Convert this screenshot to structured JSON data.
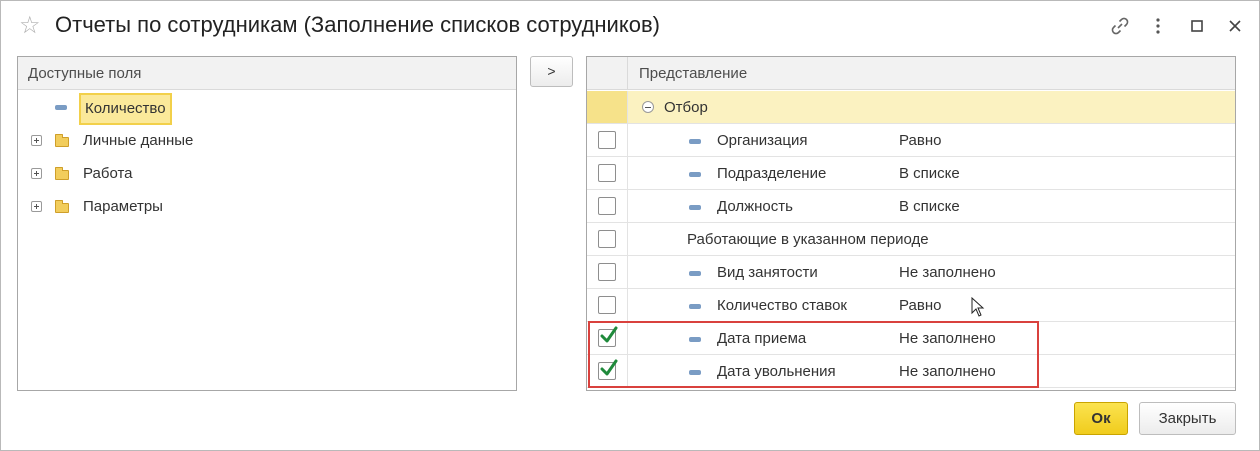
{
  "window": {
    "title": "Отчеты по сотрудникам (Заполнение списков сотрудников)"
  },
  "titlebar_icons": [
    "star-icon",
    "link-icon",
    "more-icon",
    "maximize-icon",
    "close-icon"
  ],
  "left_panel": {
    "header": "Доступные поля",
    "items": [
      {
        "label": "Количество",
        "icon": "field-icon",
        "expandable": false,
        "selected": true
      },
      {
        "label": "Личные данные",
        "icon": "folder-icon",
        "expandable": true,
        "selected": false
      },
      {
        "label": "Работа",
        "icon": "folder-icon",
        "expandable": true,
        "selected": false
      },
      {
        "label": "Параметры",
        "icon": "folder-icon",
        "expandable": true,
        "selected": false
      }
    ]
  },
  "move_button": {
    "label": ">"
  },
  "right_panel": {
    "header": "Представление",
    "group": {
      "label": "Отбор",
      "icon": "collapse-icon"
    },
    "rows": [
      {
        "label": "Организация",
        "condition": "Равно",
        "checked": false,
        "has_field_icon": true
      },
      {
        "label": "Подразделение",
        "condition": "В списке",
        "checked": false,
        "has_field_icon": true
      },
      {
        "label": "Должность",
        "condition": "В списке",
        "checked": false,
        "has_field_icon": true
      },
      {
        "label": "Работающие в указанном периоде",
        "condition": "",
        "checked": false,
        "has_field_icon": false
      },
      {
        "label": "Вид занятости",
        "condition": "Не заполнено",
        "checked": false,
        "has_field_icon": true
      },
      {
        "label": "Количество ставок",
        "condition": "Равно",
        "checked": false,
        "has_field_icon": true
      },
      {
        "label": "Дата приема",
        "condition": "Не заполнено",
        "checked": true,
        "has_field_icon": true
      },
      {
        "label": "Дата увольнения",
        "condition": "Не заполнено",
        "checked": true,
        "has_field_icon": true
      }
    ]
  },
  "footer": {
    "ok_label": "Ок",
    "close_label": "Закрыть"
  },
  "colors": {
    "accent_yellow": "#f0cc1d",
    "selection": "#fbe99a",
    "highlight_red": "#d9413d",
    "checkmark_green": "#1f8a3b"
  }
}
